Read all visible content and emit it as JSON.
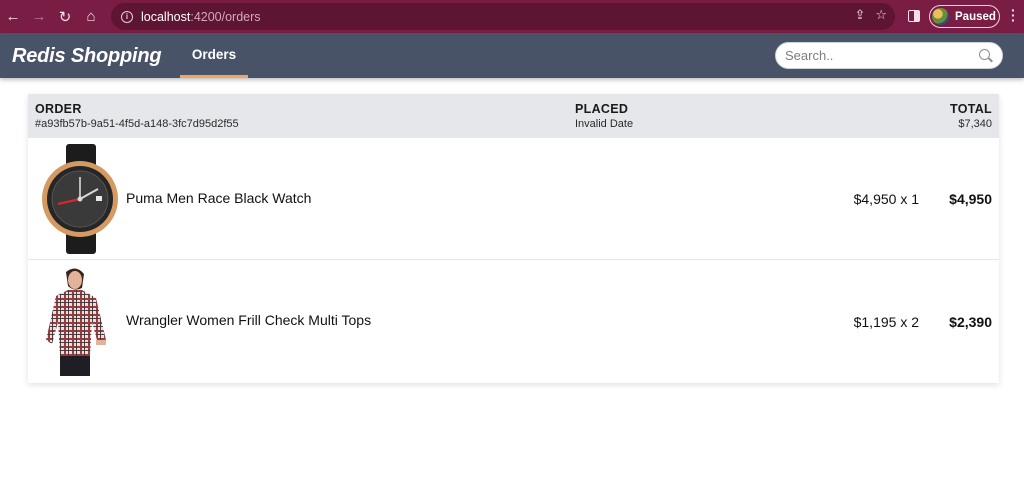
{
  "browser": {
    "url_host": "localhost",
    "url_path": ":4200/orders",
    "profile_label": "Paused"
  },
  "header": {
    "brand": "Redis Shopping",
    "nav_tab": "Orders",
    "search_placeholder": "Search.."
  },
  "order": {
    "labels": {
      "order": "ORDER",
      "placed": "PLACED",
      "total": "TOTAL"
    },
    "id": "#a93fb57b-9a51-4f5d-a148-3fc7d95d2f55",
    "placed": "Invalid Date",
    "total": "$7,340",
    "items": [
      {
        "name": "Puma Men Race Black Watch",
        "qty_text": "$4,950 x 1",
        "line_total": "$4,950",
        "image": "watch-image"
      },
      {
        "name": "Wrangler Women Frill Check Multi Tops",
        "qty_text": "$1,195 x 2",
        "line_total": "$2,390",
        "image": "checked-shirt-image"
      }
    ]
  },
  "colors": {
    "browser_chrome": "#7a1d44",
    "app_header": "#495368",
    "active_tab_underline": "#f0a35e",
    "card_header": "#e5e7eb"
  }
}
